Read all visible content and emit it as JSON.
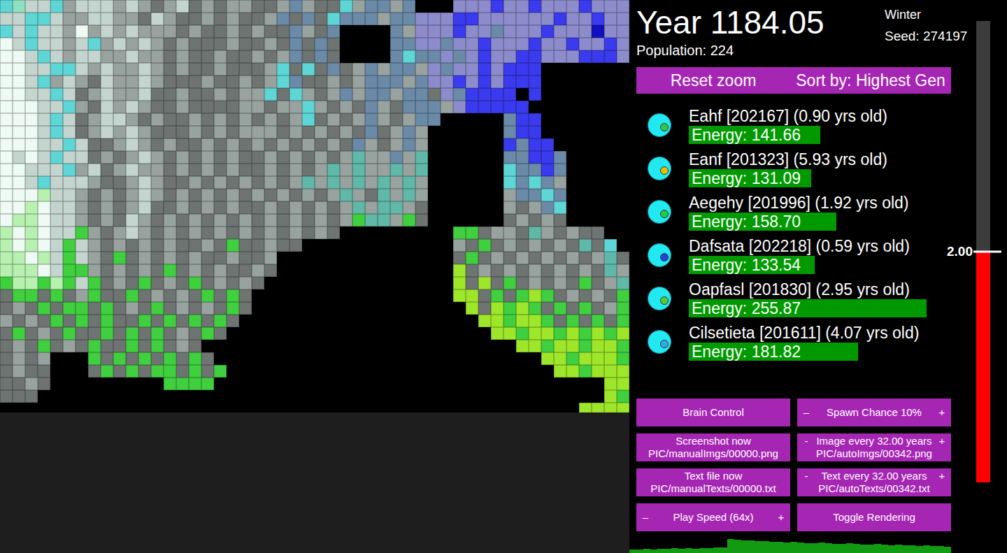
{
  "window": {
    "title": "Year 1184.05"
  },
  "header": {
    "year": "Year 1184.05",
    "population": "Population: 224",
    "season": "Winter",
    "seed": "Seed: 274197"
  },
  "top_buttons": [
    "Reset zoom",
    "Sort by: Highest Gen"
  ],
  "creatures": [
    {
      "name": "Eahf [202167] (0.90 yrs old)",
      "energy": "Energy: 141.66",
      "level": 0.47,
      "color": "#2ecc40"
    },
    {
      "name": "Eanf [201323] (5.93 yrs old)",
      "energy": "Energy: 131.09",
      "level": 0.4375,
      "color": "#e0c000"
    },
    {
      "name": "Aegehy [201996] (1.92 yrs old)",
      "energy": "Energy: 158.70",
      "level": 0.5275,
      "color": "#22cc44"
    },
    {
      "name": "Dafsata [202218] (0.59 yrs old)",
      "energy": "Energy: 133.54",
      "level": 0.45,
      "color": "#2244dd"
    },
    {
      "name": "Oapfasl [201830] (2.95 yrs old)",
      "energy": "Energy: 255.87",
      "level": 0.85,
      "color": "#55cc33"
    },
    {
      "name": "Cilsetieta [201611] (4.07 yrs old)",
      "energy": "Energy: 181.82",
      "level": 0.605,
      "color": "#33aadd"
    }
  ],
  "controls": [
    {
      "kind": "button",
      "label": "Brain Control"
    },
    {
      "kind": "stepper",
      "minus": "–",
      "label": "Spawn Chance 10%",
      "plus": "+"
    },
    {
      "kind": "button",
      "label": "Screenshot now",
      "sub": "PIC/manualImgs/00000.png"
    },
    {
      "kind": "stepper",
      "minus": "-",
      "label": "Image every 32.00 years",
      "plus": "+",
      "sub": "PIC/autoImgs/00342.png"
    },
    {
      "kind": "button",
      "label": "Text file now",
      "sub": "PIC/manualTexts/00000.txt"
    },
    {
      "kind": "stepper",
      "minus": "-",
      "label": "Text every 32.00 years",
      "plus": "+",
      "sub": "PIC/autoTexts/00342.txt"
    },
    {
      "kind": "stepper",
      "minus": "–",
      "label": "Play Speed (64x)",
      "plus": "+"
    },
    {
      "kind": "button",
      "label": "Toggle Rendering"
    }
  ],
  "gauge": {
    "label": "2.00",
    "level": 0.5
  },
  "population_chart": {
    "values": [
      5,
      5,
      6,
      5,
      6,
      6,
      7,
      6,
      7,
      6,
      7,
      7,
      8,
      8,
      20,
      19,
      18,
      18,
      17,
      17,
      16,
      16,
      15,
      16,
      15,
      14,
      14,
      15,
      14,
      13,
      13,
      14,
      13,
      12,
      12,
      13,
      12,
      11,
      12,
      11,
      11,
      10,
      11,
      10,
      10,
      9
    ]
  },
  "map": {
    "palette": {
      ".": "#000000",
      "w": "#eefaf4",
      "a": "#c4d4ce",
      "g": "#98a29e",
      "d": "#6e7472",
      "c": "#5fd6d6",
      "t": "#5fb8a8",
      "m": "#8fe0c0",
      "l": "#b8f0b0",
      "G": "#3fcf3f",
      "y": "#9ee62a",
      "p": "#8c8ccc",
      "b": "#3a3aee",
      "s": "#6a8aa8",
      "n": "#1010c0"
    },
    "rows": [
      "cmaacgaaagagdgadgdggddgsgddcgssgs...pppbppbpppbppp",
      "aaccaggaaggdagddgdgddgsdsdcsssgsspppbbppppppbppbpp",
      "cacaagwgagagggdgddgdgddsgds....sgpppbppspppbpppnpp",
      "wacaagacgagagdgdddgddgdsdsd....ssppsppbpppbppbppbp",
      "wwacagaaggaggdgddgddgdgsdsd....scsspspbppbbpppbbbp",
      "wwaaccagaggagdgddgdddgcdcdsdgsgssgpsppbpbbb.......",
      "wwacgagdaggagdddgddgdgcsddgdgsssgsppbpbpbbb.......",
      "wwaacadgaggaddgddgdggcdcgdgsgssgssdpsbbbb.b.......",
      "wwwaacgdagagddgddddggdggcgdgdsgdsssgpbbbbb........",
      "wwwacadgaagdgddgdgdgdgdgcdgdgsgdgss.....sbb.......",
      "wwwacadgagagdddgdgdgggdgdgdgdsdgsg......sbb.......",
      "wwwaacaddgagdgddgdgdgdgdgdgdsgdgsg......bsbb......",
      "wawacaadgdgagdgdgdgddgdgdgdgtggsgt......ssbbs.....",
      "wwaaacgadgaggdgdgdgddgdgdgtgtggtgt......cssbs.....",
      "wwacaaagddgagddgdgdgdgdgtgtgtgtgtg......cscsg.....",
      "wwwlaagdgdgagdgdgdgdgdgdgdgtgdtgtg......gsscs.....",
      "wwlwaagdgdgaddgdgdgddgdgdgdgtgttgd......gdgsc.....",
      "wllwaagdgdagdgdgdgdgdgdgdgdgGttgGd......dgdgd.....",
      "lwlwaaGgdgagdgdgdgdgdgdgdgd.........GGdggdtgdgdd..",
      "lwlwaGagdgdgdgddgdGddgdd............gdGdgdgdgdtdc.",
      "llwlaGagdGdgdgdgddgddg..............dGdgdgdgdgdgtd",
      "lllwaGGgdgdgdGdgdgddgd..............ydgdgdgdgdgdtg",
      "GllGlGaGdgdGdgdGdgdgd...............ydydGdgdgdGdgt",
      "dGGdGdgGddGdgdgdGdGd................yydGdGyGdgdgdG",
      "dgdGdGGdGdgdGdgdgdGd.................ydyGyGdGdGdgG",
      "gdgdGdGdGddGdGdGdGd...................yyGyyGdGdGdG",
      "dGdgdGddGdGdGdgdGd.....................yyGyyGyGyGy",
      "dgdGdgdGddGdGdgd.........................yyGyyGyyG",
      "dgdg...GdGdGdGdGd..........................yyGyyyGy",
      "dgdd...dGdGdGGdGdG..........................yyGyyyG",
      "ddgd.........GGGG...............................yyGyyy",
      "ddd.............................................yGyyyy",
      "..............................................yyyyGy"
    ]
  }
}
